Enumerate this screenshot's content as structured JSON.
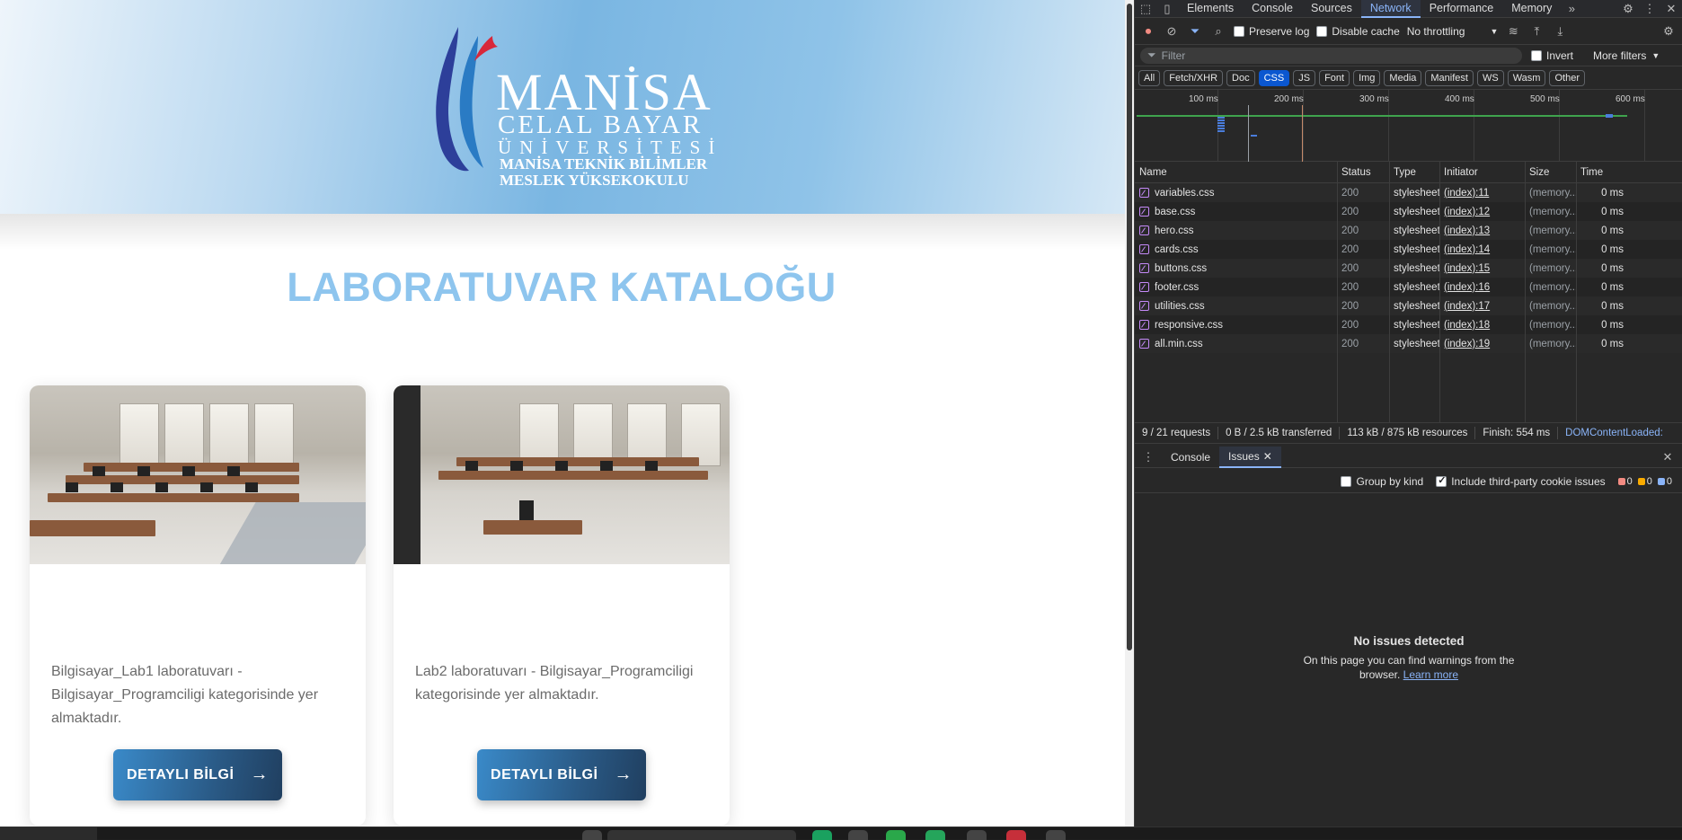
{
  "page": {
    "logo": {
      "line1": "MANİSA",
      "line2": "CELAL BAYAR",
      "line3": "ÜNİVERSİTESİ",
      "line4": "MANİSA TEKNİK BİLİMLER",
      "line5": "MESLEK YÜKSEKOKULU"
    },
    "title": "LABORATUVAR KATALOĞU",
    "cards": [
      {
        "description": "Bilgisayar_Lab1 laboratuvarı - Bilgisayar_Programciligi kategorisinde yer almaktadır.",
        "button_label": "DETAYLI BİLGİ",
        "button_arrow": "→"
      },
      {
        "description": "Lab2 laboratuvarı - Bilgisayar_Programciligi kategorisinde yer almaktadır.",
        "button_label": "DETAYLI BİLGİ",
        "button_arrow": "→"
      }
    ]
  },
  "devtools": {
    "tabs": [
      "Elements",
      "Console",
      "Sources",
      "Network",
      "Performance",
      "Memory"
    ],
    "active_tab": "Network",
    "toolbar": {
      "preserve_log": "Preserve log",
      "disable_cache": "Disable cache",
      "throttling": "No throttling"
    },
    "filter": {
      "placeholder": "Filter",
      "invert": "Invert",
      "more_filters": "More filters"
    },
    "type_filters": [
      "All",
      "Fetch/XHR",
      "Doc",
      "CSS",
      "JS",
      "Font",
      "Img",
      "Media",
      "Manifest",
      "WS",
      "Wasm",
      "Other"
    ],
    "active_type": "CSS",
    "timeline_ticks": [
      "100 ms",
      "200 ms",
      "300 ms",
      "400 ms",
      "500 ms",
      "600 ms"
    ],
    "columns": [
      "Name",
      "Status",
      "Type",
      "Initiator",
      "Size",
      "Time"
    ],
    "rows": [
      {
        "name": "variables.css",
        "status": "200",
        "type": "stylesheet",
        "initiator": "(index):11",
        "size": "(memory...",
        "time": "0 ms"
      },
      {
        "name": "base.css",
        "status": "200",
        "type": "stylesheet",
        "initiator": "(index):12",
        "size": "(memory...",
        "time": "0 ms"
      },
      {
        "name": "hero.css",
        "status": "200",
        "type": "stylesheet",
        "initiator": "(index):13",
        "size": "(memory...",
        "time": "0 ms"
      },
      {
        "name": "cards.css",
        "status": "200",
        "type": "stylesheet",
        "initiator": "(index):14",
        "size": "(memory...",
        "time": "0 ms"
      },
      {
        "name": "buttons.css",
        "status": "200",
        "type": "stylesheet",
        "initiator": "(index):15",
        "size": "(memory...",
        "time": "0 ms"
      },
      {
        "name": "footer.css",
        "status": "200",
        "type": "stylesheet",
        "initiator": "(index):16",
        "size": "(memory...",
        "time": "0 ms"
      },
      {
        "name": "utilities.css",
        "status": "200",
        "type": "stylesheet",
        "initiator": "(index):17",
        "size": "(memory...",
        "time": "0 ms"
      },
      {
        "name": "responsive.css",
        "status": "200",
        "type": "stylesheet",
        "initiator": "(index):18",
        "size": "(memory...",
        "time": "0 ms"
      },
      {
        "name": "all.min.css",
        "status": "200",
        "type": "stylesheet",
        "initiator": "(index):19",
        "size": "(memory...",
        "time": "0 ms"
      }
    ],
    "status_bar": {
      "requests": "9 / 21 requests",
      "transferred": "0 B / 2.5 kB transferred",
      "resources": "113 kB / 875 kB resources",
      "finish": "Finish: 554 ms",
      "dom_loaded": "DOMContentLoaded:"
    },
    "drawer": {
      "tabs": [
        "Console",
        "Issues"
      ],
      "active": "Issues",
      "group_by_kind": "Group by kind",
      "third_party": "Include third-party cookie issues",
      "counts": [
        "0",
        "0",
        "0"
      ],
      "empty_title": "No issues detected",
      "empty_text": "On this page you can find warnings from the browser.",
      "learn_more": "Learn more"
    }
  },
  "colors": {
    "accent": "#8ab4f8",
    "title": "#8ec5ee",
    "button": "#2a5a86"
  }
}
